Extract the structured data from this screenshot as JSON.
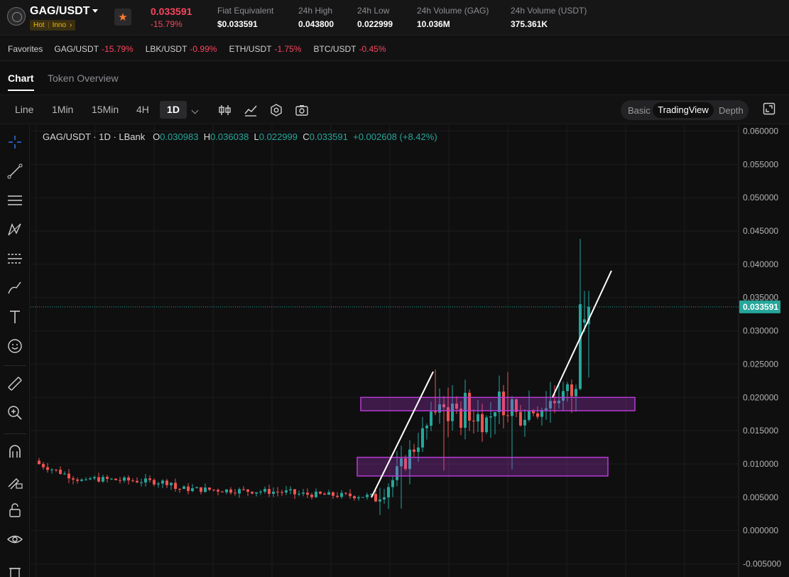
{
  "header": {
    "pair": "GAG/USDT",
    "tags": [
      "Hot",
      "Inno"
    ],
    "last_price": "0.033591",
    "change": "-15.79%",
    "stats": [
      {
        "label": "Fiat Equivalent",
        "value": "$0.033591"
      },
      {
        "label": "24h High",
        "value": "0.043800"
      },
      {
        "label": "24h Low",
        "value": "0.022999"
      },
      {
        "label": "24h Volume (GAG)",
        "value": "10.036M"
      },
      {
        "label": "24h Volume (USDT)",
        "value": "375.361K"
      }
    ],
    "favorite_icon": "star-icon"
  },
  "favorites": {
    "label": "Favorites",
    "items": [
      {
        "symbol": "GAG/USDT",
        "change": "-15.79%"
      },
      {
        "symbol": "LBK/USDT",
        "change": "-0.99%"
      },
      {
        "symbol": "ETH/USDT",
        "change": "-1.75%"
      },
      {
        "symbol": "BTC/USDT",
        "change": "-0.45%"
      }
    ]
  },
  "tabs": [
    "Chart",
    "Token Overview"
  ],
  "toolbar": {
    "timeframes": [
      "Line",
      "1Min",
      "15Min",
      "4H"
    ],
    "active_timeframe": "1D",
    "view_modes": [
      "Basic",
      "TradingView",
      "Depth"
    ],
    "active_view": "TradingView",
    "tools": [
      "candlestick-type-icon",
      "indicators-icon",
      "settings-icon",
      "screenshot-icon"
    ]
  },
  "sidebar_tools": [
    "crosshair-icon",
    "trend-line-icon",
    "horizontal-lines-icon",
    "pattern-icon",
    "fib-icon",
    "brush-icon",
    "text-icon",
    "emoji-icon",
    "ruler-icon",
    "zoom-icon",
    "magnet-icon",
    "lock-drawing-icon",
    "lock-icon",
    "eye-icon",
    "trash-icon"
  ],
  "legend": {
    "symbol": "GAG/USDT · 1D · LBank",
    "o_label": "O",
    "o": "0.030983",
    "h_label": "H",
    "h": "0.036038",
    "l_label": "L",
    "l": "0.022999",
    "c_label": "C",
    "c": "0.033591",
    "change": "+0.002608 (+8.42%)"
  },
  "colors": {
    "up": "#26a69a",
    "down": "#ef5350",
    "accent_red": "#f6465d",
    "price_tag": "#26a69a",
    "annotation_box": "#b83bd6",
    "trend_line": "#ffffff"
  },
  "chart_data": {
    "type": "candlestick",
    "y_axis_ticks": [
      "0.060000",
      "0.055000",
      "0.050000",
      "0.045000",
      "0.040000",
      "0.035000",
      "0.030000",
      "0.025000",
      "0.020000",
      "0.015000",
      "0.010000",
      "0.005000",
      "0.000000",
      "-0.005000"
    ],
    "ylim": [
      -0.005,
      0.06
    ],
    "current_price": "0.033591",
    "series_profile": "low range ~0.005-0.011 then breakout to ~0.02 range, spike to 0.0438",
    "annotation_boxes": [
      {
        "label": "",
        "y_range": [
          0.018,
          0.02
        ]
      },
      {
        "label": "",
        "y_range": [
          0.0082,
          0.011
        ]
      }
    ]
  }
}
